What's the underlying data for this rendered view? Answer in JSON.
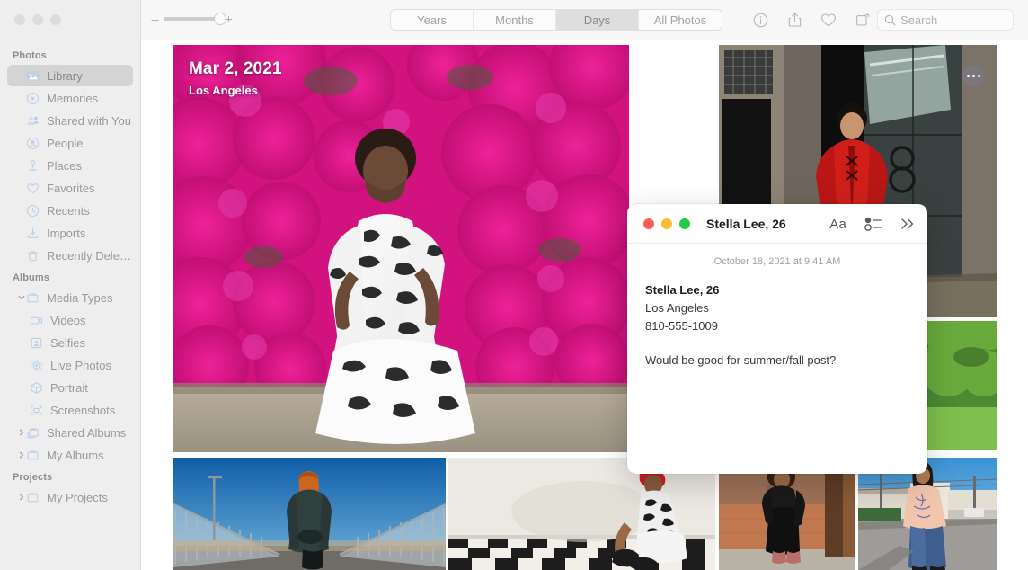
{
  "window": {
    "traffic_lights": [
      "close",
      "minimize",
      "zoom"
    ]
  },
  "sidebar": {
    "groups": [
      {
        "title": "Photos",
        "items": [
          {
            "label": "Library",
            "icon": "photos-library-icon",
            "selected": true,
            "indent": 0,
            "twisty": ""
          },
          {
            "label": "Memories",
            "icon": "memories-icon",
            "selected": false,
            "indent": 0,
            "twisty": ""
          },
          {
            "label": "Shared with You",
            "icon": "shared-with-you-icon",
            "selected": false,
            "indent": 0,
            "twisty": ""
          },
          {
            "label": "People",
            "icon": "people-icon",
            "selected": false,
            "indent": 0,
            "twisty": ""
          },
          {
            "label": "Places",
            "icon": "places-pin-icon",
            "selected": false,
            "indent": 0,
            "twisty": ""
          },
          {
            "label": "Favorites",
            "icon": "heart-icon",
            "selected": false,
            "indent": 0,
            "twisty": ""
          },
          {
            "label": "Recents",
            "icon": "clock-icon",
            "selected": false,
            "indent": 0,
            "twisty": ""
          },
          {
            "label": "Imports",
            "icon": "import-arrow-icon",
            "selected": false,
            "indent": 0,
            "twisty": ""
          },
          {
            "label": "Recently Deleted",
            "icon": "trash-icon",
            "selected": false,
            "indent": 0,
            "twisty": ""
          }
        ]
      },
      {
        "title": "Albums",
        "items": [
          {
            "label": "Media Types",
            "icon": "folder-icon",
            "selected": false,
            "indent": 0,
            "twisty": "down"
          },
          {
            "label": "Videos",
            "icon": "video-camera-icon",
            "selected": false,
            "indent": 1,
            "twisty": ""
          },
          {
            "label": "Selfies",
            "icon": "selfie-icon",
            "selected": false,
            "indent": 1,
            "twisty": ""
          },
          {
            "label": "Live Photos",
            "icon": "live-photo-icon",
            "selected": false,
            "indent": 1,
            "twisty": ""
          },
          {
            "label": "Portrait",
            "icon": "portrait-cube-icon",
            "selected": false,
            "indent": 1,
            "twisty": ""
          },
          {
            "label": "Screenshots",
            "icon": "screenshot-icon",
            "selected": false,
            "indent": 1,
            "twisty": ""
          },
          {
            "label": "Shared Albums",
            "icon": "shared-folder-icon",
            "selected": false,
            "indent": 0,
            "twisty": "right"
          },
          {
            "label": "My Albums",
            "icon": "folder-icon",
            "selected": false,
            "indent": 0,
            "twisty": "right"
          }
        ]
      },
      {
        "title": "Projects",
        "items": [
          {
            "label": "My Projects",
            "icon": "folder-icon",
            "selected": false,
            "indent": 0,
            "twisty": "right"
          }
        ]
      }
    ]
  },
  "toolbar": {
    "zoom_out_label": "–",
    "zoom_in_label": "+",
    "zoom_value": 100,
    "segments": [
      {
        "label": "Years",
        "active": false
      },
      {
        "label": "Months",
        "active": false
      },
      {
        "label": "Days",
        "active": true
      },
      {
        "label": "All Photos",
        "active": false
      }
    ],
    "icons": [
      {
        "name": "info-icon"
      },
      {
        "name": "share-icon"
      },
      {
        "name": "favorite-heart-icon"
      },
      {
        "name": "rotate-icon"
      }
    ],
    "search": {
      "placeholder": "Search",
      "value": "",
      "icon": "search-icon"
    }
  },
  "grid": {
    "hero": {
      "date": "Mar 2, 2021",
      "location": "Los Angeles"
    },
    "more_button_label": "More options",
    "photos": [
      {
        "name": "photo-woman-bougainvillea"
      },
      {
        "name": "photo-man-red-jacket"
      },
      {
        "name": "photo-person-green-yard"
      },
      {
        "name": "photo-woman-bridge"
      },
      {
        "name": "photo-woman-checkered-floor"
      },
      {
        "name": "photo-woman-brick-wall"
      },
      {
        "name": "photo-woman-street"
      }
    ]
  },
  "note": {
    "title": "Stella Lee, 26",
    "traffic_lights": {
      "close": "#ff5f57",
      "minimize": "#febc2e",
      "zoom": "#28c840"
    },
    "toolbar": {
      "format_label": "Aa",
      "checklist_icon": "checklist-icon",
      "expand_icon": "chevron-double-right-icon"
    },
    "date": "October 18, 2021 at 9:41 AM",
    "lines": [
      {
        "text": "Stella Lee, 26",
        "bold": true
      },
      {
        "text": "Los Angeles",
        "bold": false
      },
      {
        "text": "810-555-1009",
        "bold": false
      },
      {
        "text": "",
        "bold": false
      },
      {
        "text": "Would be good for summer/fall post?",
        "bold": false
      }
    ]
  },
  "colors": {
    "sidebar_bg": "#eeeeee",
    "toolbar_bg": "#f7f7f7",
    "selected_row": "#d4d4d4",
    "sidebar_icon": "#b9cfe8",
    "note_red": "#ff5f57",
    "note_yellow": "#febc2e",
    "note_green": "#28c840"
  }
}
